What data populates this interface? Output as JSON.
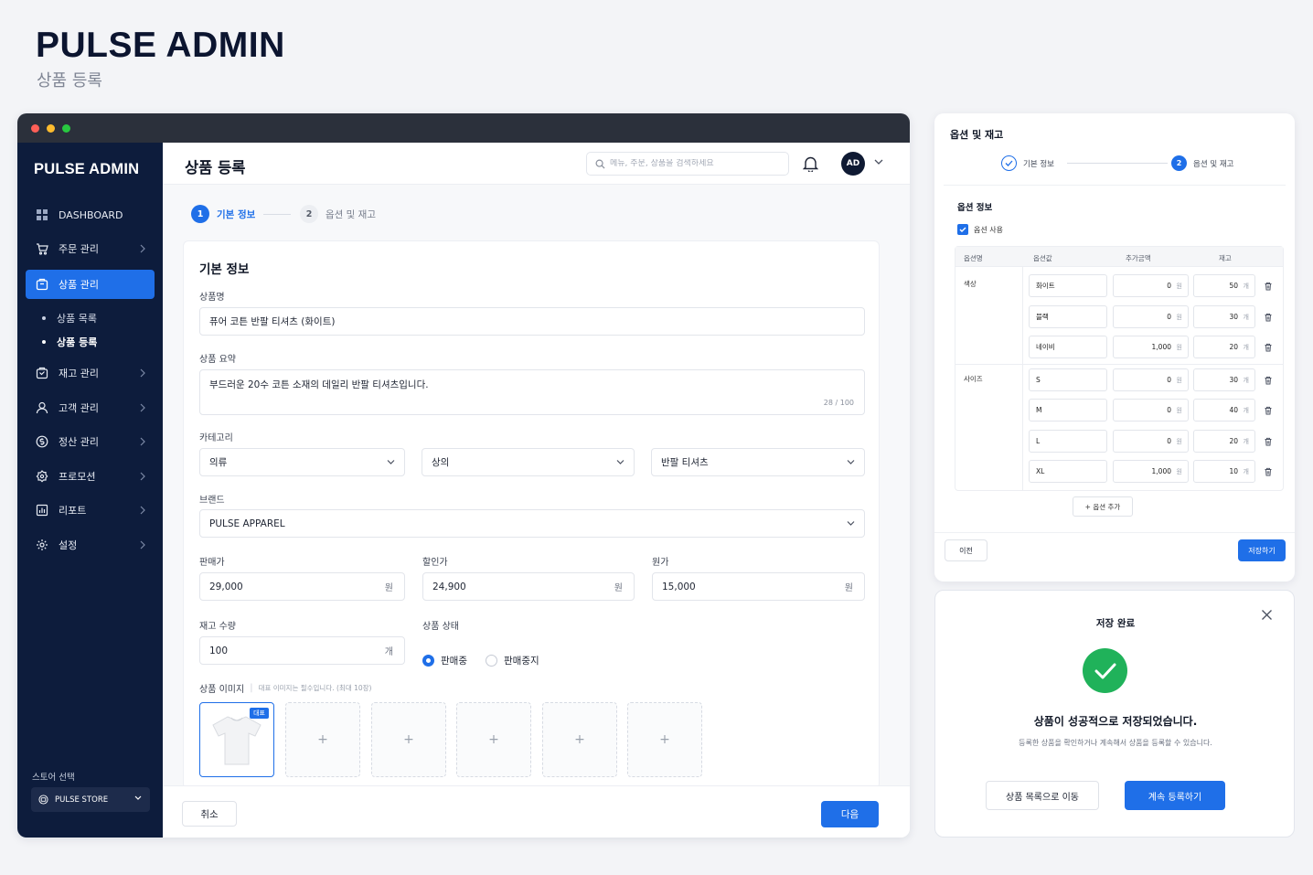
{
  "hero": {
    "title": "PULSE ADMIN",
    "subtitle": "상품 등록"
  },
  "sidebar": {
    "logo": "PULSE ADMIN",
    "items": [
      {
        "label": "DASHBOARD",
        "icon": "grid-icon"
      },
      {
        "label": "주문 관리",
        "icon": "cart-icon"
      },
      {
        "label": "상품 관리",
        "icon": "box-icon",
        "active": true
      },
      {
        "label": "재고 관리",
        "icon": "inventory-icon"
      },
      {
        "label": "고객 관리",
        "icon": "user-icon"
      },
      {
        "label": "정산 관리",
        "icon": "coin-icon"
      },
      {
        "label": "프로모션",
        "icon": "tag-icon"
      },
      {
        "label": "리포트",
        "icon": "chart-icon"
      },
      {
        "label": "설정",
        "icon": "gear-icon"
      }
    ],
    "sub_items": [
      {
        "label": "상품 목록"
      },
      {
        "label": "상품 등록",
        "current": true
      }
    ],
    "store_label": "스토어 선택",
    "store_value": "PULSE STORE"
  },
  "topbar": {
    "title": "상품 등록",
    "search_placeholder": "메뉴, 주문, 상품을 검색하세요",
    "avatar": "AD"
  },
  "steps": [
    {
      "num": "1",
      "label": "기본 정보"
    },
    {
      "num": "2",
      "label": "옵션 및 재고"
    }
  ],
  "form": {
    "section_title": "기본 정보",
    "name_label": "상품명",
    "name_value": "퓨어 코튼 반팔 티셔츠 (화이트)",
    "summary_label": "상품 요약",
    "summary_value": "부드러운 20수 코튼 소재의 데일리 반팔 티셔츠입니다.",
    "summary_counter": "28 / 100",
    "category_label": "카테고리",
    "category1": "의류",
    "category2": "상의",
    "category3": "반팔 티셔츠",
    "brand_label": "브랜드",
    "brand_value": "PULSE APPAREL",
    "price_label": "판매가",
    "price_value": "29,000",
    "discount_label": "할인가",
    "discount_value": "24,900",
    "cost_label": "원가",
    "cost_value": "15,000",
    "currency_unit": "원",
    "stock_label": "재고 수량",
    "stock_value": "100",
    "stock_unit": "개",
    "status_label": "상품 상태",
    "status_on": "판매중",
    "status_off": "판매중지",
    "image_label": "상품 이미지",
    "image_hint": "대표 이미지는 필수입니다. (최대 10장)",
    "image_badge": "대표",
    "image_add": "+"
  },
  "footer": {
    "cancel": "취소",
    "next": "다음"
  },
  "options_panel": {
    "title": "옵션 및 재고",
    "step1": "기본 정보",
    "step2": "옵션 및 재고",
    "step2_num": "2",
    "section_title": "옵션 정보",
    "use_option": "옵션 사용",
    "headers": {
      "name": "옵션명",
      "value": "옵션값",
      "price": "추가금액",
      "stock": "재고"
    },
    "color_group": "색상",
    "size_group": "사이즈",
    "rows": [
      {
        "value": "화이트",
        "price": "0",
        "stock": "50"
      },
      {
        "value": "블랙",
        "price": "0",
        "stock": "30"
      },
      {
        "value": "네이비",
        "price": "1,000",
        "stock": "20"
      },
      {
        "value": "S",
        "price": "0",
        "stock": "30"
      },
      {
        "value": "M",
        "price": "0",
        "stock": "40"
      },
      {
        "value": "L",
        "price": "0",
        "stock": "20"
      },
      {
        "value": "XL",
        "price": "1,000",
        "stock": "10"
      }
    ],
    "price_unit": "원",
    "stock_unit": "개",
    "add_option": "+ 옵션 추가",
    "prev": "이전",
    "save": "저장하기"
  },
  "modal": {
    "title": "저장 완료",
    "message": "상품이 성공적으로 저장되었습니다.",
    "sub": "등록한 상품을 확인하거나 계속해서 상품을 등록할 수 있습니다.",
    "to_list": "상품 목록으로 이동",
    "continue": "계속 등록하기"
  },
  "colors": {
    "accent": "#1f6fe8",
    "sidebar": "#0d1c3c",
    "success": "#20b25a"
  }
}
